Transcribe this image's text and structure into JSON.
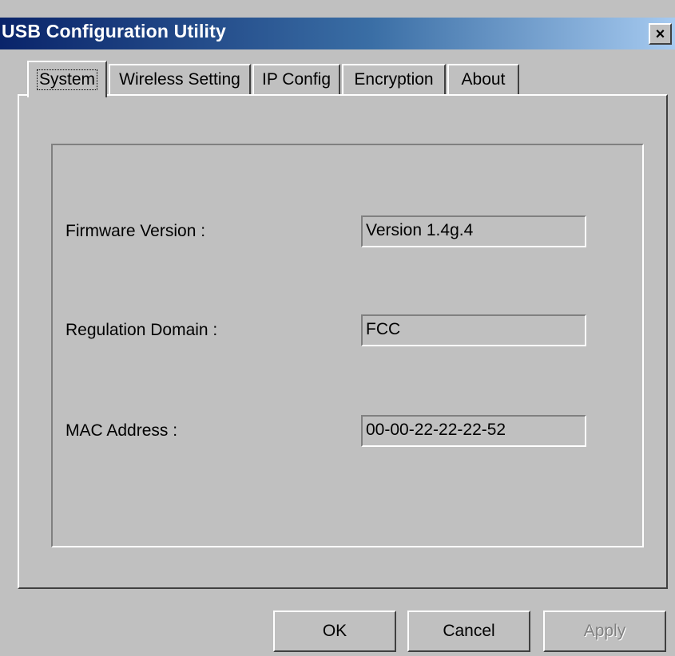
{
  "window": {
    "title": "USB Configuration Utility",
    "close_label": "×"
  },
  "tabs": [
    {
      "label": "System",
      "active": true
    },
    {
      "label": "Wireless Setting",
      "active": false
    },
    {
      "label": "IP Config",
      "active": false
    },
    {
      "label": "Encryption",
      "active": false
    },
    {
      "label": "About",
      "active": false
    }
  ],
  "system": {
    "fields": [
      {
        "label": "Firmware Version :",
        "value": "Version 1.4g.4"
      },
      {
        "label": "Regulation Domain :",
        "value": "FCC"
      },
      {
        "label": "MAC Address :",
        "value": "00-00-22-22-22-52"
      }
    ]
  },
  "buttons": {
    "ok_label": "OK",
    "cancel_label": "Cancel",
    "apply_label": "Apply",
    "apply_enabled": false
  },
  "colors": {
    "face": "#c0c0c0",
    "titlebar_start": "#0a246a",
    "titlebar_end": "#a6caf0"
  }
}
